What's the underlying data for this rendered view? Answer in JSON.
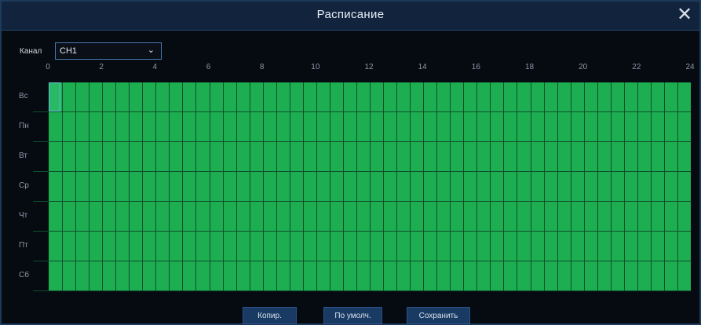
{
  "window": {
    "title": "Расписание"
  },
  "channel": {
    "label": "Канал",
    "value": "CH1"
  },
  "hours": [
    "0",
    "2",
    "4",
    "6",
    "8",
    "10",
    "12",
    "14",
    "16",
    "18",
    "20",
    "22",
    "24"
  ],
  "days": [
    "Вс",
    "Пн",
    "Вт",
    "Ср",
    "Чт",
    "Пт",
    "Сб"
  ],
  "buttons": {
    "copy": "Копир.",
    "default": "По умолч.",
    "save": "Сохранить"
  },
  "colors": {
    "schedule_fill": "#1dae52",
    "title_bar": "#12243d",
    "button": "#193a63"
  }
}
